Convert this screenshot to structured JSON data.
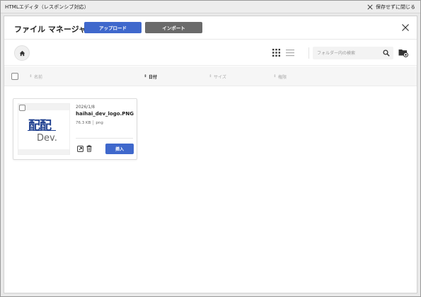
{
  "window": {
    "title": "HTMLエディタ（レスポンシブ対応）",
    "close_label": "保存せずに閉じる"
  },
  "modal": {
    "title": "ファイル マネージャ",
    "upload_label": "アップロード",
    "import_label": "インポート"
  },
  "toolbar": {
    "search_placeholder": "フォルダー内の検索"
  },
  "table": {
    "columns": [
      {
        "label": "名前",
        "active": false
      },
      {
        "label": "日付",
        "active": true
      },
      {
        "label": "サイズ",
        "active": false
      },
      {
        "label": "権限",
        "active": false
      }
    ]
  },
  "files": [
    {
      "date": "2026/1/8",
      "name": "haihai_dev_logo.PNG",
      "size": "76.3 KB",
      "type": "png",
      "thumb_text_top": "配配",
      "thumb_text_bottom": "Dev.",
      "insert_label": "挿入"
    }
  ],
  "colors": {
    "primary": "#3f68cc",
    "secondary": "#6a6a6a",
    "logo_blue": "#1e3f8f"
  }
}
